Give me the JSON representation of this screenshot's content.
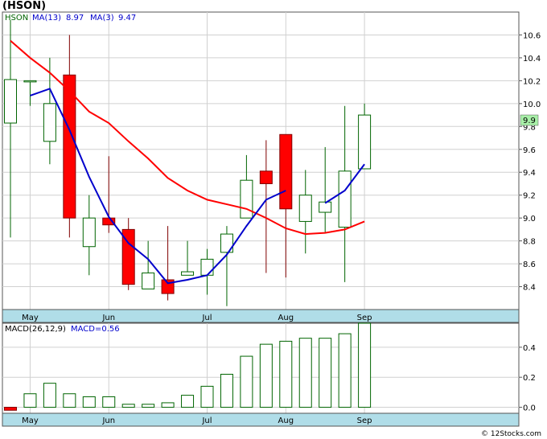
{
  "page_title": "(HSON)",
  "copyright": "© 12Stocks.com",
  "legend": {
    "ticker": "HSON",
    "ma13_label": "MA(13)",
    "ma13_value": "8.97",
    "ma3_label": "MA(3)",
    "ma3_value": "9.47"
  },
  "macd_legend": {
    "label": "MACD(26,12,9)",
    "value_label": "MACD=0.56"
  },
  "last_price_label": "9.9",
  "colors": {
    "up_candle": "#006400",
    "down_candle": "#ff0000",
    "ma13": "#ff0000",
    "ma3": "#0000cc",
    "axis_band": "#b0dde8",
    "last_price_bg": "#a8f0a8"
  },
  "chart_data": [
    {
      "type": "candlestick",
      "ylim": [
        8.2,
        10.8
      ],
      "yticks": [
        8.4,
        8.6,
        8.8,
        9.0,
        9.2,
        9.4,
        9.6,
        9.8,
        10.0,
        10.2,
        10.4,
        10.6
      ],
      "xticks": [
        {
          "label": "May",
          "index": 1
        },
        {
          "label": "Jun",
          "index": 5
        },
        {
          "label": "Jul",
          "index": 10
        },
        {
          "label": "Aug",
          "index": 14
        },
        {
          "label": "Sep",
          "index": 18
        }
      ],
      "candles": [
        {
          "open": 9.83,
          "high": 10.73,
          "low": 8.83,
          "close": 10.21
        },
        {
          "open": 10.2,
          "high": 10.2,
          "low": 9.98,
          "close": 10.2
        },
        {
          "open": 9.67,
          "high": 10.4,
          "low": 9.47,
          "close": 10.0
        },
        {
          "open": 10.25,
          "high": 10.6,
          "low": 8.83,
          "close": 9.0
        },
        {
          "open": 8.75,
          "high": 9.2,
          "low": 8.5,
          "close": 9.0
        },
        {
          "open": 9.0,
          "high": 9.54,
          "low": 8.87,
          "close": 8.94
        },
        {
          "open": 8.9,
          "high": 9.0,
          "low": 8.37,
          "close": 8.42
        },
        {
          "open": 8.38,
          "high": 8.8,
          "low": 8.38,
          "close": 8.52
        },
        {
          "open": 8.46,
          "high": 8.93,
          "low": 8.28,
          "close": 8.34
        },
        {
          "open": 8.5,
          "high": 8.8,
          "low": 8.5,
          "close": 8.53
        },
        {
          "open": 8.5,
          "high": 8.73,
          "low": 8.33,
          "close": 8.64
        },
        {
          "open": 8.7,
          "high": 8.93,
          "low": 8.23,
          "close": 8.86
        },
        {
          "open": 9.0,
          "high": 9.55,
          "low": 9.0,
          "close": 9.33
        },
        {
          "open": 9.41,
          "high": 9.68,
          "low": 8.52,
          "close": 9.3
        },
        {
          "open": 9.73,
          "high": 9.73,
          "low": 8.48,
          "close": 9.08
        },
        {
          "open": 8.97,
          "high": 9.42,
          "low": 8.69,
          "close": 9.2
        },
        {
          "open": 9.05,
          "high": 9.62,
          "low": 8.87,
          "close": 9.14
        },
        {
          "open": 8.92,
          "high": 9.98,
          "low": 8.44,
          "close": 9.41
        },
        {
          "open": 9.43,
          "high": 10.0,
          "low": 9.43,
          "close": 9.9
        }
      ],
      "series": [
        {
          "name": "MA(13)",
          "values": [
            10.55,
            10.4,
            10.27,
            10.11,
            9.93,
            9.83,
            9.67,
            9.52,
            9.35,
            9.24,
            9.16,
            9.12,
            9.08,
            9.0,
            8.91,
            8.86,
            8.87,
            8.9,
            8.97
          ]
        },
        {
          "name": "MA(3)",
          "values": [
            null,
            10.07,
            10.13,
            9.77,
            9.36,
            9.01,
            8.78,
            8.64,
            8.43,
            8.46,
            8.5,
            8.68,
            8.93,
            9.16,
            9.24,
            null,
            9.13,
            9.24,
            9.47
          ]
        }
      ]
    },
    {
      "type": "bar",
      "ylim": [
        -0.04,
        0.56
      ],
      "yticks": [
        0.0,
        0.2,
        0.4
      ],
      "xticks": [
        {
          "label": "May",
          "index": 1
        },
        {
          "label": "Jun",
          "index": 5
        },
        {
          "label": "Jul",
          "index": 10
        },
        {
          "label": "Aug",
          "index": 14
        },
        {
          "label": "Sep",
          "index": 18
        }
      ],
      "values": [
        -0.02,
        0.09,
        0.16,
        0.09,
        0.07,
        0.07,
        0.02,
        0.02,
        0.03,
        0.08,
        0.14,
        0.22,
        0.34,
        0.42,
        0.44,
        0.46,
        0.46,
        0.49,
        0.56
      ]
    }
  ]
}
